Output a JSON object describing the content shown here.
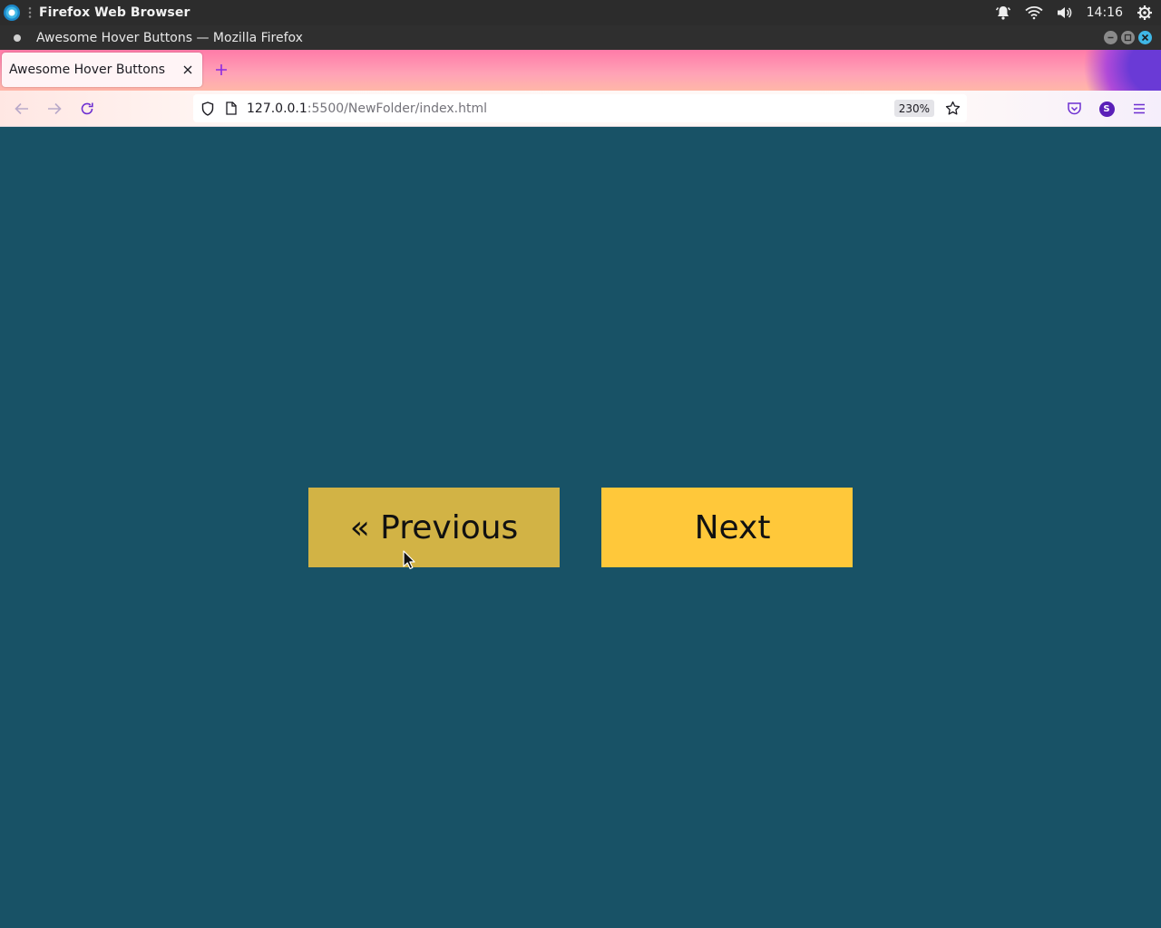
{
  "system_bar": {
    "app_name": "Firefox Web Browser",
    "clock": "14:16"
  },
  "window": {
    "title": "Awesome Hover Buttons — Mozilla Firefox"
  },
  "tabs": [
    {
      "label": "Awesome Hover Buttons",
      "active": true
    }
  ],
  "url_bar": {
    "host": "127.0.0.1",
    "rest": ":5500/NewFolder/index.html",
    "zoom": "230%"
  },
  "profile": {
    "initial": "S"
  },
  "page": {
    "background": "#185266",
    "buttons": {
      "previous_label": "« Previous",
      "previous_color": "#d2b345",
      "next_label": "Next",
      "next_color": "#ffc83a"
    }
  }
}
